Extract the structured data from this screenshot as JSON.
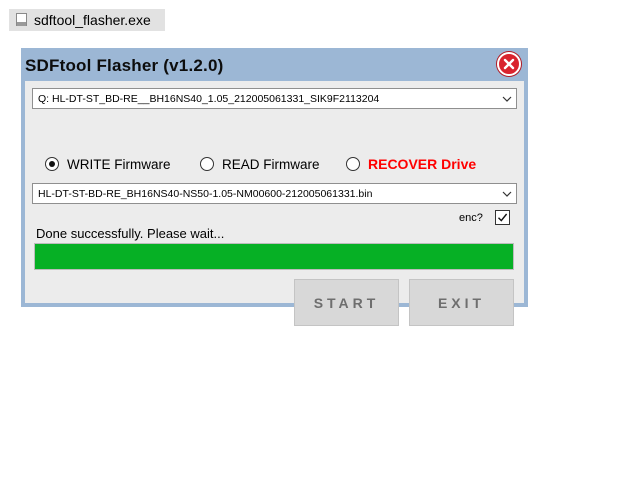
{
  "file_tag": {
    "filename": "sdftool_flasher.exe",
    "icon": "file-icon"
  },
  "window": {
    "title": "SDFtool Flasher (v1.2.0)",
    "close_icon": "close-icon",
    "accent_color": "#9cb7d5"
  },
  "drive_select": {
    "value": "Q:  HL-DT-ST_BD-RE__BH16NS40_1.05_212005061331_SIK9F2113204"
  },
  "modes": {
    "write_label": "WRITE Firmware",
    "read_label": "READ Firmware",
    "recover_label": "RECOVER Drive",
    "selected": "write",
    "recover_color": "#ff0000"
  },
  "firmware_select": {
    "value": "HL-DT-ST-BD-RE_BH16NS40-NS50-1.05-NM00600-212005061331.bin"
  },
  "enc": {
    "label": "enc?",
    "checked": true
  },
  "status": {
    "text": "Done successfully. Please wait..."
  },
  "progress": {
    "percent": 100,
    "color": "#06b025"
  },
  "buttons": {
    "start_label": "START",
    "exit_label": "EXIT"
  }
}
